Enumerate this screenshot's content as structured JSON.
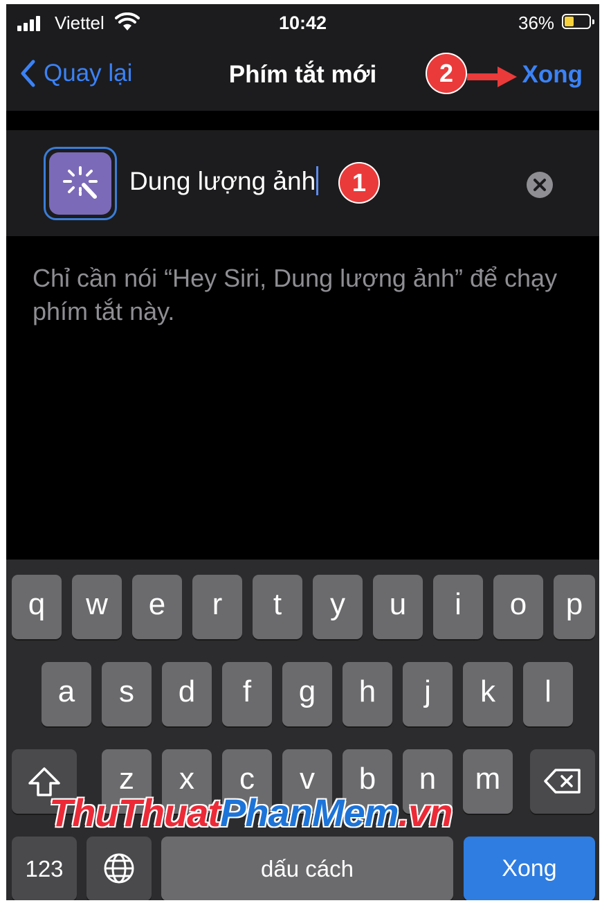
{
  "status_bar": {
    "carrier": "Viettel",
    "time": "10:42",
    "battery_percent": "36%"
  },
  "nav": {
    "back_label": "Quay lại",
    "title": "Phím tắt mới",
    "done_label": "Xong"
  },
  "annotations": {
    "step1": "1",
    "step2": "2"
  },
  "shortcut": {
    "name": "Dung lượng ảnh",
    "icon": "magic-wand-icon",
    "icon_color": "#7b6ab8"
  },
  "hint": "Chỉ cần nói “Hey Siri, Dung lượng ảnh” để chạy phím tắt này.",
  "keyboard": {
    "row1": [
      "q",
      "w",
      "e",
      "r",
      "t",
      "y",
      "u",
      "i",
      "o",
      "p"
    ],
    "row2": [
      "a",
      "s",
      "d",
      "f",
      "g",
      "h",
      "j",
      "k",
      "l"
    ],
    "row3": [
      "z",
      "x",
      "c",
      "v",
      "b",
      "n",
      "m"
    ],
    "numbers_label": "123",
    "space_label": "dấu cách",
    "return_label": "Xong"
  },
  "watermark": {
    "part1": "ThuThuat",
    "part2": "PhanMem",
    "part3": ".vn"
  },
  "colors": {
    "accent": "#3b82f6",
    "badge": "#ea3a3a",
    "return_key": "#2f7de1"
  }
}
